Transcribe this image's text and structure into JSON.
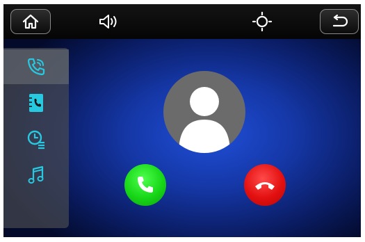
{
  "topbar": {
    "home": {
      "icon": "home-icon"
    },
    "volume": {
      "icon": "volume-icon"
    },
    "brightness": {
      "icon": "brightness-icon"
    },
    "back": {
      "icon": "back-icon"
    }
  },
  "sidebar": {
    "items": [
      {
        "name": "dialer",
        "icon": "phone-icon",
        "active": true
      },
      {
        "name": "contacts",
        "icon": "contacts-book-icon",
        "active": false
      },
      {
        "name": "call-history",
        "icon": "call-history-icon",
        "active": false
      },
      {
        "name": "music",
        "icon": "music-note-icon",
        "active": false
      }
    ]
  },
  "call": {
    "avatar": {
      "icon": "person-icon"
    },
    "answer": {
      "icon": "answer-call-icon",
      "color": "#17d617"
    },
    "decline": {
      "icon": "end-call-icon",
      "color": "#e31010"
    }
  },
  "colors": {
    "accent": "#27c9e0",
    "background": "#1537a6"
  }
}
